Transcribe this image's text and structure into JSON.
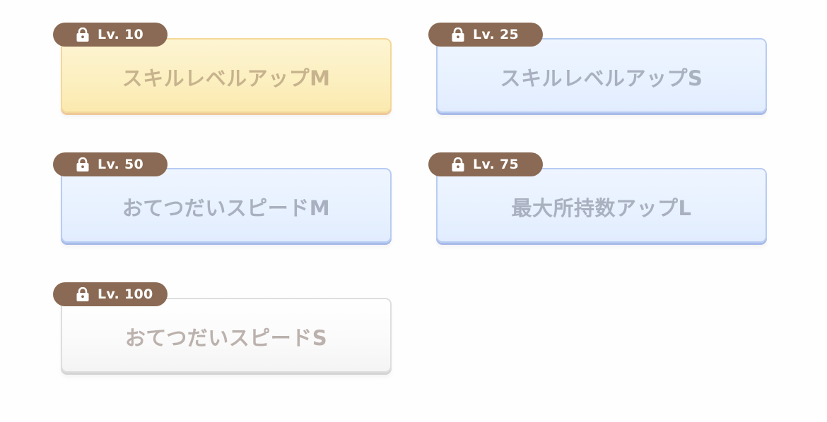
{
  "skills": [
    {
      "level": "Lv. 10",
      "name": "スキルレベルアップM",
      "state": "locked",
      "theme": "yellow"
    },
    {
      "level": "Lv. 25",
      "name": "スキルレベルアップS",
      "state": "locked",
      "theme": "blue"
    },
    {
      "level": "Lv. 50",
      "name": "おてつだいスピードM",
      "state": "locked",
      "theme": "blue"
    },
    {
      "level": "Lv. 75",
      "name": "最大所持数アップL",
      "state": "locked",
      "theme": "blue"
    },
    {
      "level": "Lv. 100",
      "name": "おてつだいスピードS",
      "state": "locked",
      "theme": "white"
    }
  ],
  "icons": {
    "lock": "lock-icon"
  },
  "colors": {
    "badge": "#8a6a54",
    "card_yellow": "#fcefbf",
    "card_blue": "#e7f1ff",
    "card_white": "#fafafa"
  }
}
